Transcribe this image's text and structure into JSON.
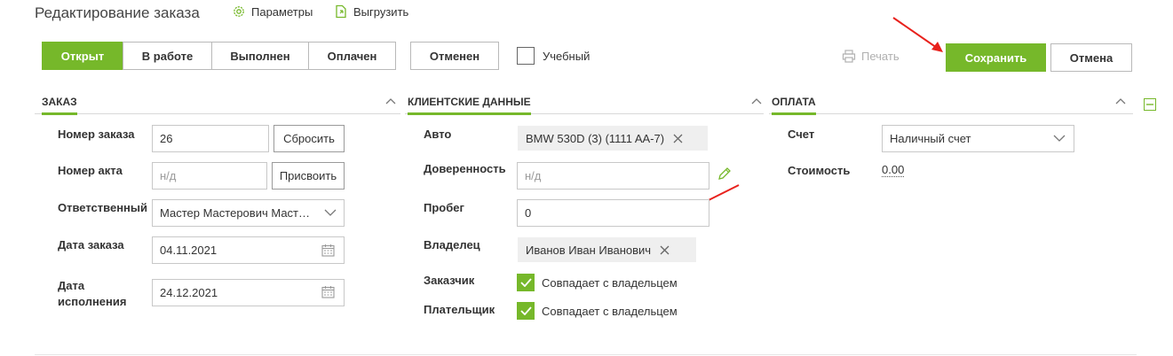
{
  "header": {
    "title": "Редактирование заказа",
    "params_label": "Параметры",
    "export_label": "Выгрузить"
  },
  "status": {
    "buttons": [
      "Открыт",
      "В работе",
      "Выполнен",
      "Оплачен"
    ],
    "active_index": 0,
    "cancelled_label": "Отменен",
    "training_label": "Учебный",
    "training_checked": false
  },
  "actions": {
    "print_label": "Печать",
    "save_label": "Сохранить",
    "cancel_label": "Отмена"
  },
  "order": {
    "section_title": "ЗАКАЗ",
    "order_number_label": "Номер заказа",
    "order_number_value": "26",
    "reset_label": "Сбросить",
    "act_number_label": "Номер акта",
    "act_number_placeholder": "н/д",
    "assign_label": "Присвоить",
    "responsible_label": "Ответственный",
    "responsible_value": "Мастер Мастерович Маст…",
    "order_date_label": "Дата заказа",
    "order_date_value": "04.11.2021",
    "completion_date_label_1": "Дата",
    "completion_date_label_2": "исполнения",
    "completion_date_value": "24.12.2021"
  },
  "client": {
    "section_title": "КЛИЕНТСКИЕ ДАННЫЕ",
    "auto_label": "Авто",
    "auto_value": "BMW 530D (3) (1111 AA-7)",
    "proxy_label": "Доверенность",
    "proxy_placeholder": "н/д",
    "mileage_label": "Пробег",
    "mileage_value": "0",
    "owner_label": "Владелец",
    "owner_value": "Иванов Иван Иванович",
    "customer_label": "Заказчик",
    "customer_value": "Совпадает с владельцем",
    "payer_label": "Плательщик",
    "payer_value": "Совпадает с владельцем"
  },
  "payment": {
    "section_title": "ОПЛАТА",
    "account_label": "Счет",
    "account_value": "Наличный счет",
    "cost_label": "Стоимость",
    "cost_value": "0.00"
  },
  "colors": {
    "accent": "#76b82a",
    "arrow": "#e8211c"
  }
}
